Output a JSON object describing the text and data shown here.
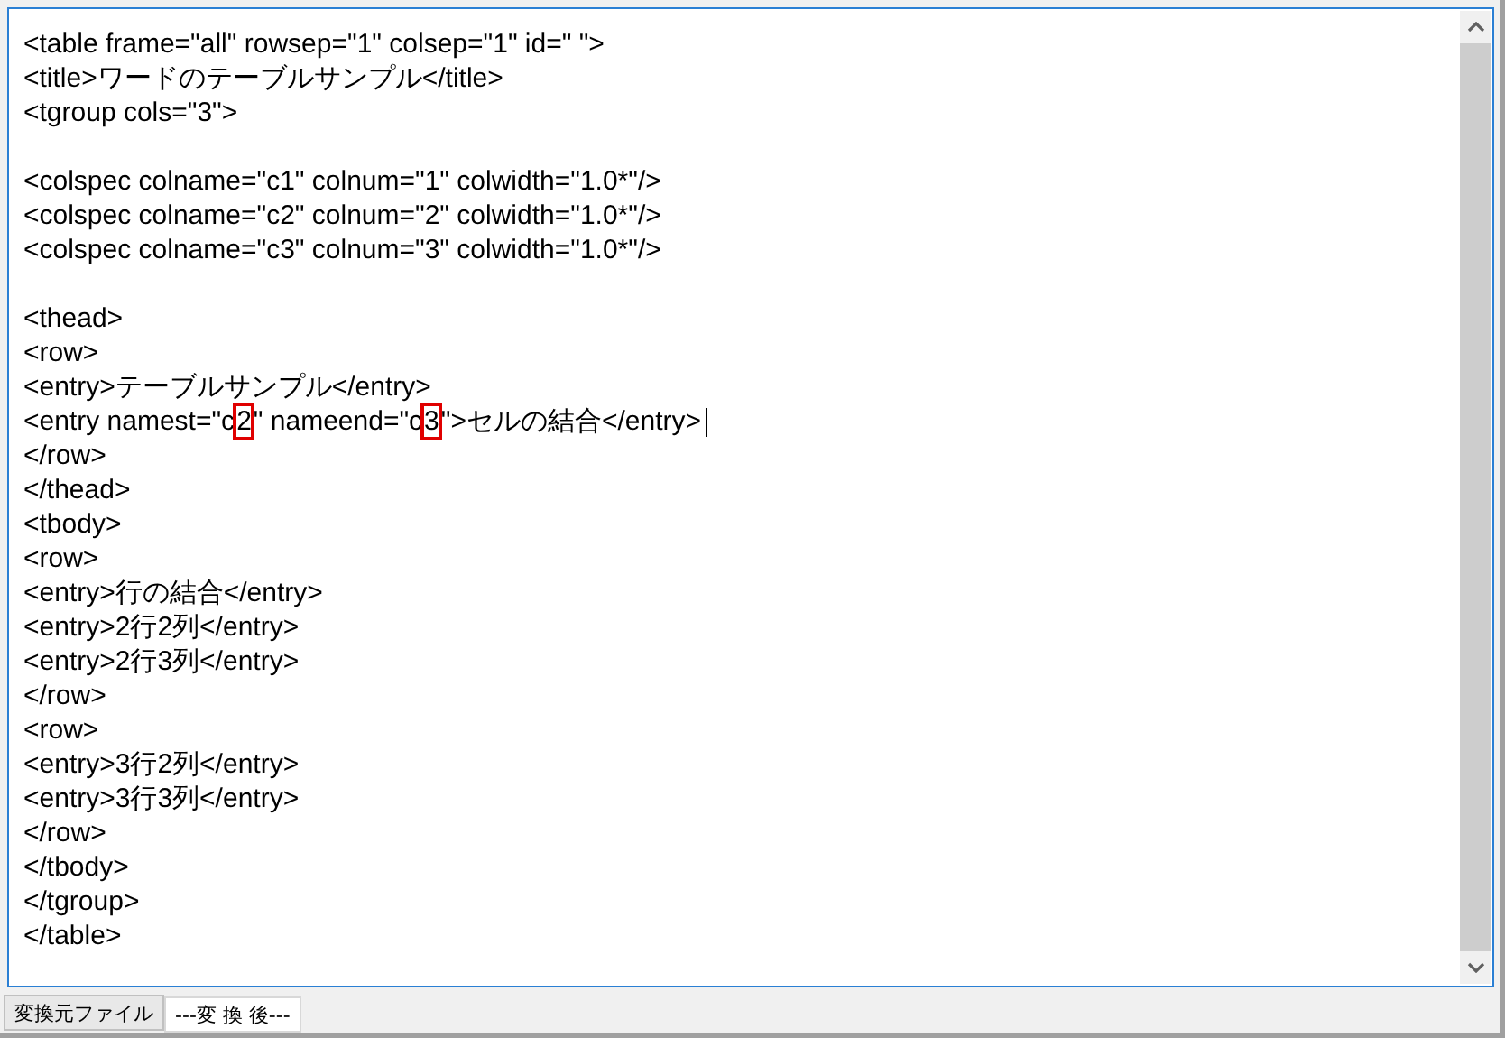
{
  "editor": {
    "lines": [
      {
        "kind": "text",
        "text": "<table frame=\"all\" rowsep=\"1\" colsep=\"1\" id=\" \">"
      },
      {
        "kind": "text",
        "text": "<title>ワードのテーブルサンプル</title>"
      },
      {
        "kind": "text",
        "text": "<tgroup cols=\"3\">"
      },
      {
        "kind": "blank"
      },
      {
        "kind": "text",
        "text": "<colspec colname=\"c1\" colnum=\"1\" colwidth=\"1.0*\"/>"
      },
      {
        "kind": "text",
        "text": "<colspec colname=\"c2\" colnum=\"2\" colwidth=\"1.0*\"/>"
      },
      {
        "kind": "text",
        "text": "<colspec colname=\"c3\" colnum=\"3\" colwidth=\"1.0*\"/>"
      },
      {
        "kind": "blank"
      },
      {
        "kind": "text",
        "text": "<thead>"
      },
      {
        "kind": "text",
        "text": "<row>"
      },
      {
        "kind": "text",
        "text": "<entry>テーブルサンプル</entry>"
      },
      {
        "kind": "marked",
        "caret": true,
        "segments": [
          {
            "text": "<entry namest=\"c",
            "boxed": false
          },
          {
            "text": "2",
            "boxed": true
          },
          {
            "text": "\" nameend=\"c",
            "boxed": false
          },
          {
            "text": "3",
            "boxed": true
          },
          {
            "text": "\">セルの結合</entry>",
            "boxed": false
          }
        ]
      },
      {
        "kind": "text",
        "text": "</row>"
      },
      {
        "kind": "text",
        "text": "</thead>"
      },
      {
        "kind": "text",
        "text": "<tbody>"
      },
      {
        "kind": "text",
        "text": "<row>"
      },
      {
        "kind": "text",
        "text": "<entry>行の結合</entry>"
      },
      {
        "kind": "text",
        "text": "<entry>2行2列</entry>"
      },
      {
        "kind": "text",
        "text": "<entry>2行3列</entry>"
      },
      {
        "kind": "text",
        "text": "</row>"
      },
      {
        "kind": "text",
        "text": "<row>"
      },
      {
        "kind": "text",
        "text": "<entry>3行2列</entry>"
      },
      {
        "kind": "text",
        "text": "<entry>3行3列</entry>"
      },
      {
        "kind": "text",
        "text": "</row>"
      },
      {
        "kind": "text",
        "text": "</tbody>"
      },
      {
        "kind": "text",
        "text": "</tgroup>"
      },
      {
        "kind": "text",
        "text": "</table>"
      }
    ]
  },
  "tabs": [
    {
      "label": "変換元ファイル",
      "selected": true
    },
    {
      "label": "---変 換 後---",
      "selected": false
    }
  ]
}
